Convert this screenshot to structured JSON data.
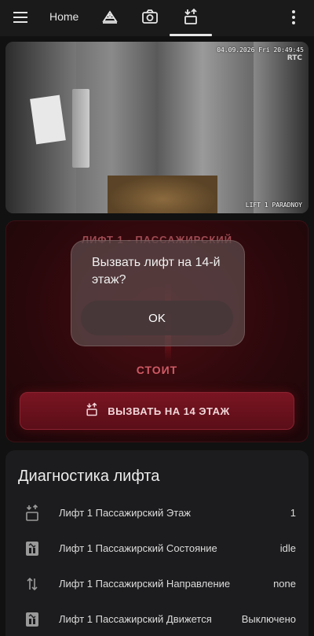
{
  "topbar": {
    "home_label": "Home",
    "tabs": [
      {
        "icon": "robot-vacuum-icon"
      },
      {
        "icon": "camera-icon"
      },
      {
        "icon": "elevator-icon",
        "active": true
      }
    ],
    "menu_icon": "hamburger-menu-icon",
    "more_icon": "more-vertical-icon"
  },
  "camera": {
    "timestamp": "04.09.2026 Fri 20:49:45",
    "brand": "RTC",
    "label": "LIFT 1 PARADNOY"
  },
  "lift_card": {
    "title": "ЛИФТ 1 - ПАССАЖИРСКИЙ",
    "status": "СТОИТ",
    "call_button_label": "ВЫЗВАТЬ НА 14 ЭТАЖ",
    "accent_color": "#7a1522"
  },
  "popup": {
    "message": "Вызвать лифт на 14-й этаж?",
    "ok_label": "OK"
  },
  "diagnostics": {
    "title": "Диагностика лифта",
    "rows": [
      {
        "icon": "elevator-floor-icon",
        "name": "Лифт 1 Пассажирский Этаж",
        "value": "1"
      },
      {
        "icon": "elevator-state-icon",
        "name": "Лифт 1 Пассажирский Состояние",
        "value": "idle"
      },
      {
        "icon": "direction-arrows-icon",
        "name": "Лифт 1 Пассажирский Направление",
        "value": "none"
      },
      {
        "icon": "elevator-moving-icon",
        "name": "Лифт 1 Пассажирский Движется",
        "value": "Выключено"
      }
    ]
  }
}
